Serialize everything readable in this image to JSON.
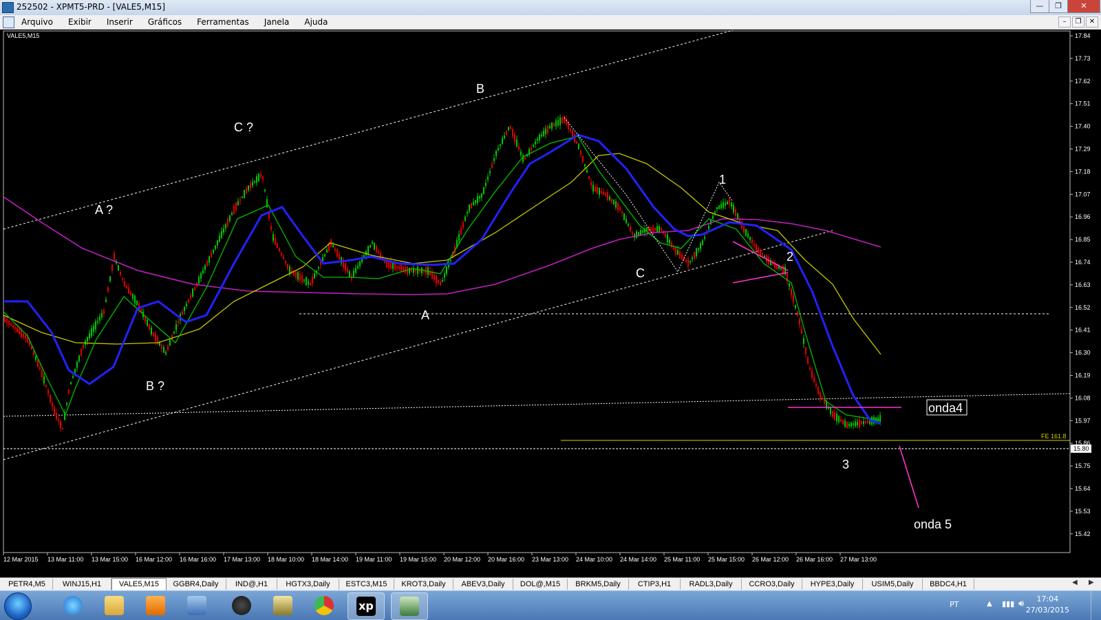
{
  "window": {
    "title": "252502 - XPMT5-PRD - [VALE5,M15]",
    "controls": [
      "minimize",
      "restore",
      "close"
    ]
  },
  "menu": {
    "items": [
      "Arquivo",
      "Exibir",
      "Inserir",
      "Gráficos",
      "Ferramentas",
      "Janela",
      "Ajuda"
    ]
  },
  "chart": {
    "symbol_label": "VALE5,M15",
    "price_axis": [
      "17.84",
      "17.73",
      "17.62",
      "17.51",
      "17.40",
      "17.29",
      "17.18",
      "17.07",
      "16.96",
      "16.85",
      "16.74",
      "16.63",
      "16.52",
      "16.41",
      "16.30",
      "16.19",
      "16.08",
      "15.97",
      "15.86",
      "15.75",
      "15.64",
      "15.53",
      "15.42"
    ],
    "current_price_label": "15.80",
    "fe_label": "FE 161.8",
    "time_axis": [
      "12 Mar 2015",
      "13 Mar 11:00",
      "13 Mar 15:00",
      "16 Mar 12:00",
      "16 Mar 16:00",
      "17 Mar 13:00",
      "18 Mar 10:00",
      "18 Mar 14:00",
      "19 Mar 11:00",
      "19 Mar 15:00",
      "20 Mar 12:00",
      "20 Mar 16:00",
      "23 Mar 13:00",
      "24 Mar 10:00",
      "24 Mar 14:00",
      "25 Mar 11:00",
      "25 Mar 15:00",
      "26 Mar 12:00",
      "26 Mar 16:00",
      "27 Mar 13:00"
    ],
    "annotations": {
      "a_q": "A ?",
      "c_q": "C ?",
      "b": "B",
      "b_q": "B ?",
      "a": "A",
      "c": "C",
      "w1": "1",
      "w2": "2",
      "w3": "3",
      "onda4": "onda4",
      "onda5": "onda 5"
    },
    "colors": {
      "bullish": "#00c800",
      "bearish": "#e00000",
      "ma_fast": "#2020ff",
      "ma_green": "#00c000",
      "ma_yellow": "#c8c800",
      "ma_magenta": "#c020c0",
      "trendline": "#ffffff",
      "pink_lines": "#ff33cc",
      "fe_line": "#d4d400"
    }
  },
  "tabs": {
    "items": [
      "PETR4,M5",
      "WINJ15,H1",
      "VALE5,M15",
      "GGBR4,Daily",
      "IND@,H1",
      "HGTX3,Daily",
      "ESTC3,M15",
      "KROT3,Daily",
      "ABEV3,Daily",
      "DOL@,M15",
      "BRKM5,Daily",
      "CTIP3,H1",
      "RADL3,Daily",
      "CCRO3,Daily",
      "HYPE3,Daily",
      "USIM5,Daily",
      "BBDC4,H1"
    ],
    "active": "VALE5,M15"
  },
  "taskbar": {
    "buttons": [
      "start-button",
      "internet-explorer",
      "file-explorer",
      "media-player",
      "network-app",
      "hp-app",
      "finance-app",
      "chrome",
      "xp-investimentos",
      "metatrader"
    ],
    "language": "PT",
    "time": "17:04",
    "date": "27/03/2015"
  }
}
